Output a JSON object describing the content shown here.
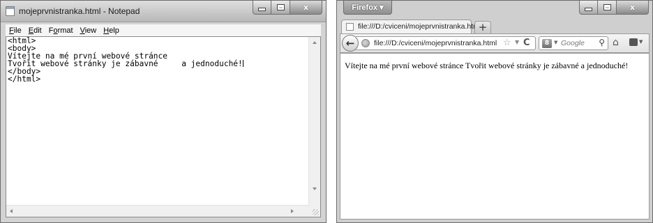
{
  "notepad": {
    "title": "mojeprvnistranka.html - Notepad",
    "controls": {
      "minimize": "minimize",
      "maximize": "maximize",
      "close": "x"
    },
    "menu": [
      {
        "key": "F",
        "rest": "ile"
      },
      {
        "key": "E",
        "rest": "dit"
      },
      {
        "pre": "F",
        "key": "o",
        "rest": "rmat"
      },
      {
        "key": "V",
        "rest": "iew"
      },
      {
        "key": "H",
        "rest": "elp"
      }
    ],
    "lines": [
      "<html>",
      "<body>",
      "Vítejte na mé první webové stránce",
      "Tvořit webové stránky je zábavné     a jednoduché!",
      "</body>",
      "</html>"
    ]
  },
  "firefox": {
    "menu_button": "Firefox ▾",
    "tab_label": "file:///D:/cviceni/mojeprvnistranka.html",
    "new_tab": "+",
    "url": "file:///D:/cviceni/mojeprvnistranka.html",
    "search_placeholder": "Google",
    "page_text": "Vítejte na mé první webové stránce Tvořit webové stránky je zábavné a jednoduché!",
    "icons": [
      "back-arrow-icon",
      "globe-icon",
      "star-icon",
      "reload-icon",
      "search-engine-icon",
      "magnifier-icon",
      "home-icon",
      "bookmarks-icon"
    ]
  }
}
